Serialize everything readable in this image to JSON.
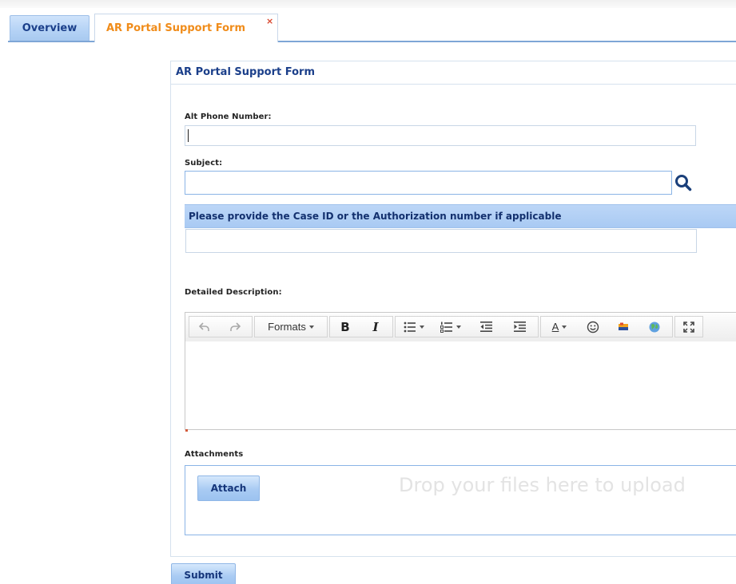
{
  "tabs": {
    "overview_label": "Overview",
    "active_label": "AR Portal Support Form",
    "close_glyph": "×"
  },
  "form": {
    "title": "AR Portal Support Form",
    "alt_phone": {
      "label": "Alt Phone Number:",
      "value": ""
    },
    "subject": {
      "label": "Subject:",
      "value": ""
    },
    "case_section": {
      "label": "Please provide the Case ID or the Authorization number if applicable",
      "value": ""
    },
    "description": {
      "label": "Detailed Description:"
    },
    "toolbar": {
      "formats_label": "Formats",
      "bold_label": "B",
      "italic_label": "I",
      "font_color_label": "A"
    },
    "attachments": {
      "label": "Attachments",
      "attach_label": "Attach",
      "drop_text": "Drop your files here to upload"
    },
    "submit_label": "Submit"
  },
  "colors": {
    "tab_active_text": "#f08c1a",
    "header_text": "#1b3f8a",
    "button_blue": "#a9cbf3",
    "close_red": "#d8452c"
  },
  "icons": {
    "search": "search-icon",
    "undo": "undo-icon",
    "redo": "redo-icon",
    "bullet_list": "bullet-list-icon",
    "numbered_list": "numbered-list-icon",
    "outdent": "outdent-icon",
    "indent": "indent-icon",
    "emoticon": "emoticon-icon",
    "image": "image-icon",
    "link": "globe-link-icon",
    "fullscreen": "fullscreen-icon"
  }
}
